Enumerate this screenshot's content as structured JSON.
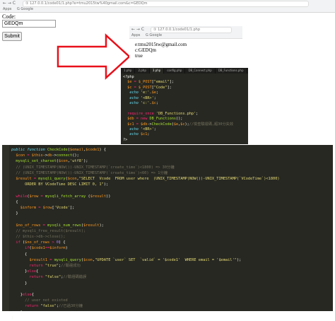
{
  "browser1": {
    "nav": "← → C",
    "url": "① 127.0.0.1/code01/1.php?e=tmu2015tw%40gmail.com&c=GEDQm",
    "bookmarks": [
      "Apps",
      "G Google"
    ]
  },
  "form": {
    "code_label": "Code:",
    "code_value": "GEDQm",
    "submit_label": "Submit"
  },
  "browser2": {
    "nav": "← → C",
    "url": "① 127.0.0.1/code01/1.php",
    "bookmarks": [
      "Apps",
      "G Google"
    ],
    "output": [
      "e:tmu2015tw@gmail.com",
      "c:GEDQm",
      "true"
    ]
  },
  "editor_small": {
    "tabs": [
      "1.php",
      "2.php",
      "3.php",
      "config.php",
      "DB_Connect.php",
      "DB_Functions.php"
    ],
    "active_tab": 2,
    "lines": [
      [
        [
          "pl",
          "<?php"
        ]
      ],
      [
        [
          "pl",
          "  "
        ],
        [
          "vr",
          "$e"
        ],
        [
          "kp",
          " = "
        ],
        [
          "vr",
          "$_POST"
        ],
        [
          "pl",
          "["
        ],
        [
          "st",
          "\"email\""
        ],
        [
          "pl",
          "];"
        ]
      ],
      [
        [
          "pl",
          "  "
        ],
        [
          "vr",
          "$c"
        ],
        [
          "kp",
          " = "
        ],
        [
          "vr",
          "$_POST"
        ],
        [
          "pl",
          "["
        ],
        [
          "st",
          "\"Code\""
        ],
        [
          "pl",
          "];"
        ]
      ],
      [
        [
          "pl",
          "   "
        ],
        [
          "kw",
          "echo"
        ],
        [
          "pl",
          " "
        ],
        [
          "st",
          "'e:'"
        ],
        [
          "pl",
          "."
        ],
        [
          "vr",
          "$e"
        ],
        [
          "pl",
          ";"
        ]
      ],
      [
        [
          "pl",
          "   "
        ],
        [
          "kw",
          "echo"
        ],
        [
          "pl",
          " "
        ],
        [
          "st",
          "'<BR>'"
        ],
        [
          "pl",
          ";"
        ]
      ],
      [
        [
          "pl",
          "   "
        ],
        [
          "kw",
          "echo"
        ],
        [
          "pl",
          " "
        ],
        [
          "st",
          "'c:'"
        ],
        [
          "pl",
          "."
        ],
        [
          "vr",
          "$c"
        ],
        [
          "pl",
          ";"
        ]
      ],
      [
        [
          "pl",
          ""
        ]
      ],
      [
        [
          "pl",
          "  "
        ],
        [
          "kp",
          "require_once"
        ],
        [
          "pl",
          " "
        ],
        [
          "st",
          "'DB_Functions.php'"
        ],
        [
          "pl",
          ";"
        ]
      ],
      [
        [
          "pl",
          "  "
        ],
        [
          "vr",
          "$db"
        ],
        [
          "kp",
          " = "
        ],
        [
          "kp",
          "new "
        ],
        [
          "fn",
          "DB_Functions"
        ],
        [
          "pl",
          "();"
        ]
      ],
      [
        [
          "pl",
          "  "
        ],
        [
          "vr",
          "$c1"
        ],
        [
          "kp",
          " = "
        ],
        [
          "vr",
          "$db"
        ],
        [
          "pl",
          "->"
        ],
        [
          "fn",
          "CheckCode"
        ],
        [
          "pl",
          "("
        ],
        [
          "vr",
          "$e"
        ],
        [
          "pl",
          ","
        ],
        [
          "vr",
          "$c"
        ],
        [
          "pl",
          ");"
        ],
        [
          "cm",
          "//檢查驗證碼,超30分失效"
        ]
      ],
      [
        [
          "pl",
          "   "
        ],
        [
          "kw",
          "echo"
        ],
        [
          "pl",
          " "
        ],
        [
          "st",
          "'<BR>'"
        ],
        [
          "pl",
          ";"
        ]
      ],
      [
        [
          "pl",
          "   "
        ],
        [
          "kw",
          "echo"
        ],
        [
          "pl",
          " "
        ],
        [
          "vr",
          "$c1"
        ],
        [
          "pl",
          ";"
        ]
      ],
      [
        [
          "pl",
          "?>"
        ]
      ]
    ]
  },
  "editor_large": {
    "lines": [
      [
        [
          "kw",
          "public "
        ],
        [
          "kw",
          "function "
        ],
        [
          "fn",
          "CheckCode"
        ],
        [
          "pl",
          "("
        ],
        [
          "vr",
          "$email"
        ],
        [
          "pl",
          ","
        ],
        [
          "vr",
          "$code1"
        ],
        [
          "pl",
          ") {"
        ]
      ],
      [
        [
          "pl",
          "  "
        ],
        [
          "vr",
          "$con"
        ],
        [
          "kp",
          " = "
        ],
        [
          "vr",
          "$this"
        ],
        [
          "pl",
          "->"
        ],
        [
          "vr",
          "db"
        ],
        [
          "pl",
          "->"
        ],
        [
          "fn",
          "connect"
        ],
        [
          "pl",
          "();"
        ]
      ],
      [
        [
          "pl",
          "  "
        ],
        [
          "fn",
          "mysqli_set_charset"
        ],
        [
          "pl",
          "("
        ],
        [
          "vr",
          "$con"
        ],
        [
          "pl",
          ","
        ],
        [
          "st",
          "'utf8'"
        ],
        [
          "pl",
          ");"
        ]
      ],
      [
        [
          "cm",
          "  // (UNIX_TIMESTAMP(NOW())-UNIX_TIMESTAMP(`create_time`)<1800) => 30分鐘"
        ]
      ],
      [
        [
          "cm",
          "  // (UNIX_TIMESTAMP(NOW())-UNIX_TIMESTAMP(`create_time`)<60) => 1分鐘"
        ]
      ],
      [
        [
          "pl",
          "  "
        ],
        [
          "vr",
          "$result"
        ],
        [
          "kp",
          " = "
        ],
        [
          "fn",
          "mysqli_query"
        ],
        [
          "pl",
          "("
        ],
        [
          "vr",
          "$con"
        ],
        [
          "pl",
          ","
        ],
        [
          "st",
          "\"SELECT  Vcode  FROM user where  (UNIX_TIMESTAMP(NOW())-UNIX_TIMESTAMP(`VCodeTime`)<1800)"
        ]
      ],
      [
        [
          "st",
          "      ORDER BY VCodeTime DESC LIMIT 0, 1\""
        ],
        [
          "pl",
          ");"
        ]
      ],
      [
        [
          "pl",
          ""
        ]
      ],
      [
        [
          "pl",
          "  "
        ],
        [
          "kp",
          "while"
        ],
        [
          "pl",
          "("
        ],
        [
          "vr",
          "$row"
        ],
        [
          "kp",
          " = "
        ],
        [
          "fn",
          "mysqli_fetch_array"
        ],
        [
          "pl",
          " ("
        ],
        [
          "vr",
          "$result"
        ],
        [
          "pl",
          "))"
        ]
      ],
      [
        [
          "pl",
          "  {"
        ]
      ],
      [
        [
          "pl",
          "    "
        ],
        [
          "vr",
          "$inform"
        ],
        [
          "kp",
          " = "
        ],
        [
          "vr",
          "$row"
        ],
        [
          "pl",
          "["
        ],
        [
          "st",
          "'Vcode'"
        ],
        [
          "pl",
          "];"
        ]
      ],
      [
        [
          "pl",
          "  }"
        ]
      ],
      [
        [
          "pl",
          ""
        ]
      ],
      [
        [
          "pl",
          "  "
        ],
        [
          "vr",
          "$no_of_rows"
        ],
        [
          "kp",
          " = "
        ],
        [
          "fn",
          "mysqli_num_rows"
        ],
        [
          "pl",
          "("
        ],
        [
          "vr",
          "$result"
        ],
        [
          "pl",
          ");"
        ]
      ],
      [
        [
          "cm",
          "  // mysqli_free_result($result);"
        ]
      ],
      [
        [
          "cm",
          "  // $this->db->close();"
        ]
      ],
      [
        [
          "pl",
          "  "
        ],
        [
          "kp",
          "if"
        ],
        [
          "pl",
          " ("
        ],
        [
          "vr",
          "$no_of_rows"
        ],
        [
          "kp",
          " > "
        ],
        [
          "nb",
          "0"
        ],
        [
          "pl",
          ") {"
        ]
      ],
      [
        [
          "pl",
          "      "
        ],
        [
          "kp",
          "if"
        ],
        [
          "pl",
          "("
        ],
        [
          "vr",
          "$code1"
        ],
        [
          "kp",
          "=="
        ],
        [
          "vr",
          "$inform"
        ],
        [
          "pl",
          ")"
        ]
      ],
      [
        [
          "pl",
          "      {"
        ]
      ],
      [
        [
          "pl",
          "        "
        ],
        [
          "vr",
          "$result1"
        ],
        [
          "kp",
          " = "
        ],
        [
          "fn",
          "mysqli_query"
        ],
        [
          "pl",
          "("
        ],
        [
          "vr",
          "$con"
        ],
        [
          "pl",
          ","
        ],
        [
          "st",
          "\"UPDATE `user` SET  `valid` = '$code1'  WHERE email = '$email'\""
        ],
        [
          "pl",
          ");"
        ]
      ],
      [
        [
          "pl",
          "        "
        ],
        [
          "kp",
          "return"
        ],
        [
          "pl",
          " "
        ],
        [
          "st",
          "\"true\""
        ],
        [
          "pl",
          ";"
        ],
        [
          "cm",
          "//驗證成功"
        ]
      ],
      [
        [
          "pl",
          "      }"
        ],
        [
          "kp",
          "else"
        ],
        [
          "pl",
          "{"
        ]
      ],
      [
        [
          "pl",
          "        "
        ],
        [
          "kp",
          "return"
        ],
        [
          "pl",
          " "
        ],
        [
          "st",
          "\"false\""
        ],
        [
          "pl",
          ";"
        ],
        [
          "cm",
          "//驗證碼錯誤"
        ]
      ],
      [
        [
          "pl",
          "      }"
        ]
      ],
      [
        [
          "pl",
          ""
        ]
      ],
      [
        [
          "pl",
          "    }"
        ],
        [
          "kp",
          "else"
        ],
        [
          "pl",
          "{"
        ]
      ],
      [
        [
          "cm",
          "      // user not existed"
        ]
      ],
      [
        [
          "pl",
          "      "
        ],
        [
          "kp",
          "return"
        ],
        [
          "pl",
          " "
        ],
        [
          "st",
          "\"false\""
        ],
        [
          "pl",
          ";"
        ],
        [
          "cm",
          "//已過30分鐘"
        ]
      ],
      [
        [
          "pl",
          "    }"
        ]
      ],
      [
        [
          "pl",
          "}"
        ]
      ]
    ]
  }
}
